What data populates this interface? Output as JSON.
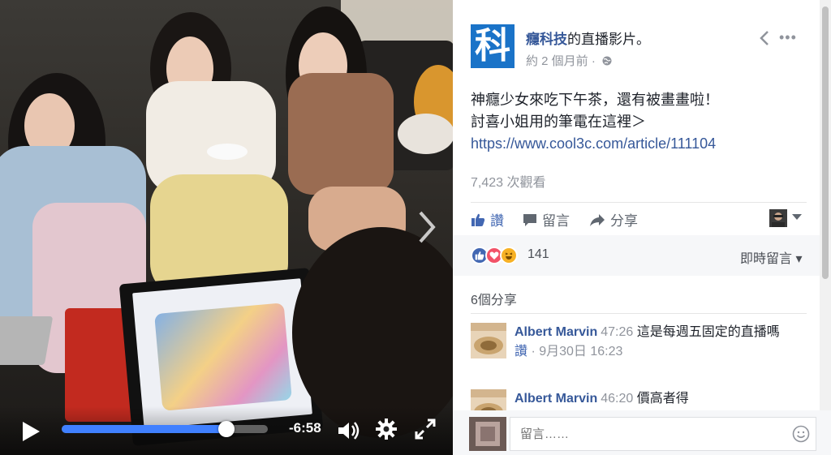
{
  "video": {
    "time_remaining": "-6:58",
    "progress": 0.8
  },
  "post": {
    "page_logo_char": "科",
    "page_name": "癮科技",
    "header_suffix": "的直播影片。",
    "timestamp": "約 2 個月前 · ",
    "more_label": "•••",
    "text_line1": "神癮少女來吃下午茶，還有被畫畫啦！",
    "text_line2": "討喜小姐用的筆電在這裡＞",
    "link": "https://www.cool3c.com/article/111104",
    "views": "7,423 次觀看",
    "actions": {
      "like": "讚",
      "comment": "留言",
      "share": "分享"
    },
    "reaction_count": "141",
    "live_comments": "即時留言 ▾",
    "shares": "6個分享",
    "comments": [
      {
        "name": "Albert Marvin",
        "time": "47:26",
        "text": "這是每週五固定的直播嗎",
        "like": "讚",
        "date": " · 9月30日 16:23"
      },
      {
        "name": "Albert Marvin",
        "time": "46:20",
        "text": "價高者得"
      }
    ],
    "compose_placeholder": "留言……"
  },
  "colors": {
    "brand": "#1a73c8",
    "link": "#365899",
    "progress": "#4080ff",
    "like": "#4267b2",
    "love": "#f25268",
    "haha": "#f7b125"
  }
}
